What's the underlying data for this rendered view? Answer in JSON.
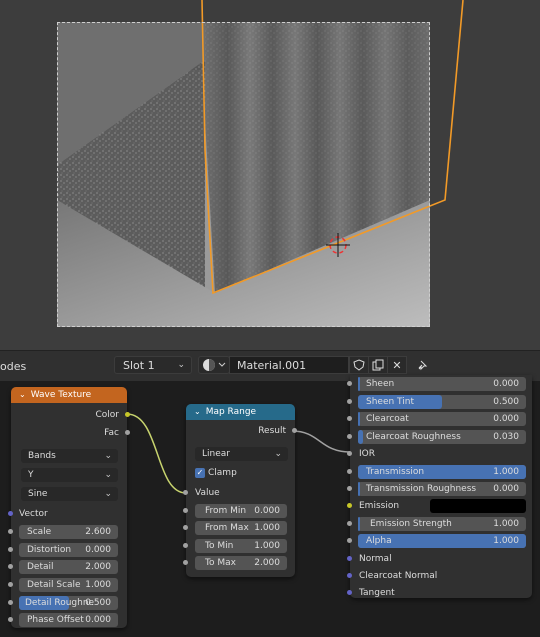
{
  "header": {
    "editor_label": "odes",
    "slot": "Slot 1",
    "material_name": "Material.001"
  },
  "wave_texture": {
    "title": "Wave Texture",
    "outputs": [
      "Color",
      "Fac"
    ],
    "wave_type": "Bands",
    "direction": "Y",
    "profile": "Sine",
    "vector_label": "Vector",
    "fields": [
      {
        "label": "Scale",
        "value": "2.600"
      },
      {
        "label": "Distortion",
        "value": "0.000"
      },
      {
        "label": "Detail",
        "value": "2.000"
      },
      {
        "label": "Detail Scale",
        "value": "1.000"
      },
      {
        "label": "Detail Roughne",
        "value": "0.500",
        "fraction": 0.5
      },
      {
        "label": "Phase Offset",
        "value": "0.000"
      }
    ]
  },
  "map_range": {
    "title": "Map Range",
    "output": "Result",
    "interpolation": "Linear",
    "clamp_label": "Clamp",
    "clamp_checked": true,
    "value_label": "Value",
    "fields": [
      {
        "label": "From Min",
        "value": "0.000"
      },
      {
        "label": "From Max",
        "value": "1.000"
      },
      {
        "label": "To Min",
        "value": "1.000"
      },
      {
        "label": "To Max",
        "value": "2.000"
      }
    ]
  },
  "bsdf": {
    "rows": [
      {
        "kind": "field",
        "label": "Sheen",
        "value": "0.000",
        "fraction": 0
      },
      {
        "kind": "field",
        "label": "Sheen Tint",
        "value": "0.500",
        "fraction": 0.5
      },
      {
        "kind": "field",
        "label": "Clearcoat",
        "value": "0.000",
        "fraction": 0
      },
      {
        "kind": "field",
        "label": "Clearcoat Roughness",
        "value": "0.030",
        "fraction": 0.03
      },
      {
        "kind": "label",
        "label": "IOR"
      },
      {
        "kind": "field",
        "label": "Transmission",
        "value": "1.000",
        "fraction": 1
      },
      {
        "kind": "field",
        "label": "Transmission Roughness",
        "value": "0.000",
        "fraction": 0
      },
      {
        "kind": "color",
        "label": "Emission",
        "color": "#000000"
      },
      {
        "kind": "field",
        "label": "Emission Strength",
        "value": "1.000",
        "fraction": 0
      },
      {
        "kind": "field",
        "label": "Alpha",
        "value": "1.000",
        "fraction": 1
      },
      {
        "kind": "label",
        "label": "Normal"
      },
      {
        "kind": "label",
        "label": "Clearcoat Normal"
      },
      {
        "kind": "label",
        "label": "Tangent"
      }
    ]
  },
  "colors": {
    "wave_header": "#c3651f",
    "map_range_header": "#266a8a",
    "accent_blue": "#4772b3",
    "selection_orange": "#f29a27",
    "link_color_green": "#c7d36e"
  }
}
